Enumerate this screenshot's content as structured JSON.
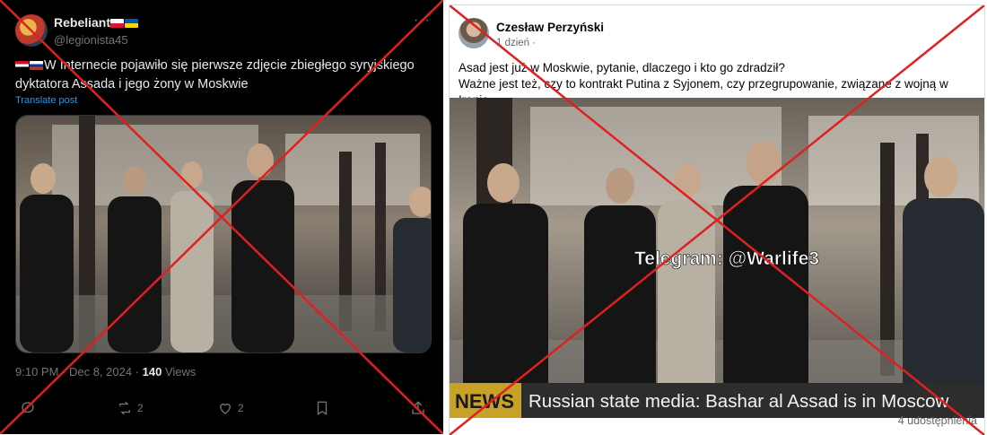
{
  "left_post": {
    "author_name": "Rebeliant",
    "author_handle": "@legionista45",
    "text": "W Internecie pojawiło się pierwsze zdjęcie zbiegłego syryjskiego dyktatora Assada i jego żony w Moskwie",
    "translate_label": "Translate post",
    "timestamp": "9:10 PM · Dec 8, 2024 · ",
    "views_count": "140",
    "views_label": " Views",
    "retweets": "2",
    "likes": "2",
    "more_label": "···"
  },
  "right_post": {
    "author_name": "Czesław Perzyński",
    "time_label": "1 dzień ·",
    "text_line1": "Asad jest już w Moskwie, pytanie, dlaczego i kto go zdradził?",
    "text_line2": "Ważne jest też, czy to kontrakt Putina z Syjonem, czy przegrupowanie, związane z wojną w Iranie.",
    "watermark": "Telegram: @Warlife3",
    "news_tag": "NEWS",
    "news_ticker": "Russian state media: Bashar al Assad is in Moscow",
    "shares_label": "4 udostępnienia"
  },
  "colors": {
    "cross": "#e02020",
    "tw_bg": "#000000",
    "tw_link": "#1d9bf0",
    "fb_text": "#050505",
    "fb_muted": "#65676b"
  },
  "icons": [
    "reply-icon",
    "retweet-icon",
    "heart-icon",
    "bookmark-icon",
    "share-icon",
    "more-icon"
  ]
}
